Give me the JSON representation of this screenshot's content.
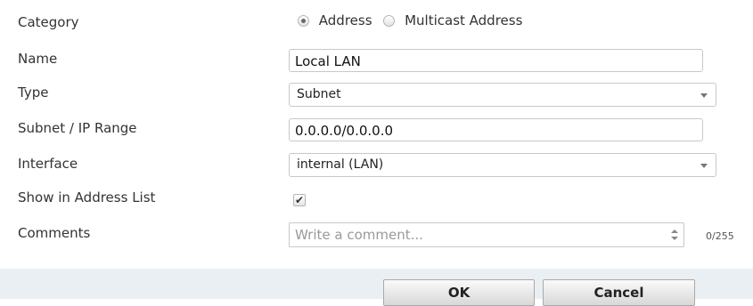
{
  "form": {
    "category": {
      "label": "Category",
      "options": [
        {
          "label": "Address",
          "selected": true
        },
        {
          "label": "Multicast Address",
          "selected": false
        }
      ]
    },
    "name": {
      "label": "Name",
      "value": "Local LAN"
    },
    "type": {
      "label": "Type",
      "value": "Subnet"
    },
    "subnet": {
      "label": "Subnet / IP Range",
      "value": "0.0.0.0/0.0.0.0"
    },
    "interface": {
      "label": "Interface",
      "value": "internal (LAN)"
    },
    "show_in_list": {
      "label": "Show in Address List",
      "checked": true,
      "check_glyph": "✔"
    },
    "comments": {
      "label": "Comments",
      "placeholder": "Write a comment...",
      "counter": "0/255"
    }
  },
  "buttons": {
    "ok": "OK",
    "cancel": "Cancel"
  },
  "colors": {
    "footer_bg": "#e9eff2",
    "border": "#c8c8c8",
    "text": "#333333"
  }
}
